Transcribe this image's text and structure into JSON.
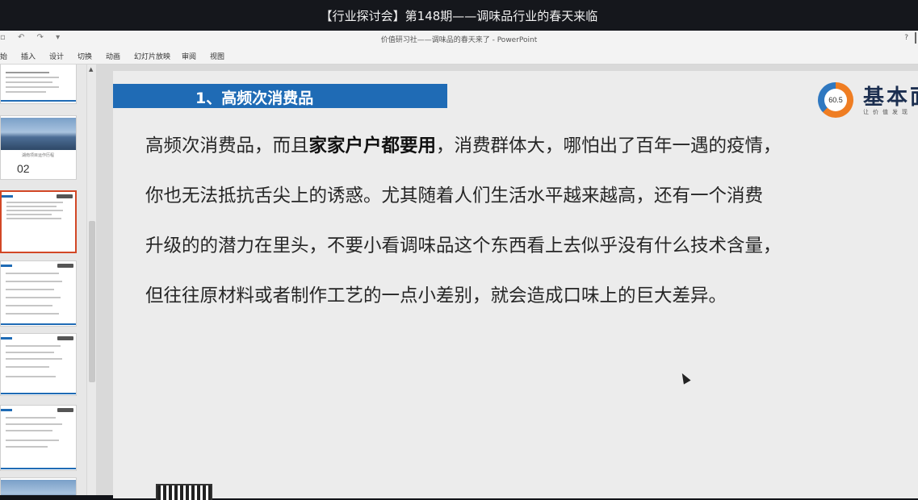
{
  "video": {
    "title": "【行业探讨会】第148期——调味品行业的春天来临"
  },
  "window": {
    "title": "价值研习社——调味品的春天来了 - PowerPoint",
    "help": "?"
  },
  "quick_access": {
    "icons": [
      "save-icon",
      "undo-icon",
      "redo-icon",
      "customize-icon"
    ]
  },
  "ribbon": {
    "tabs": [
      "始",
      "插入",
      "设计",
      "切换",
      "动画",
      "幻灯片放映",
      "审阅",
      "视图"
    ]
  },
  "thumbnails": {
    "section_number": "02",
    "section_caption": "湖南项目运作历程"
  },
  "slide": {
    "heading": "1、高频次消费品",
    "logo": {
      "score": "60.5",
      "name": "基本面",
      "tagline": "让价值发现"
    },
    "paragraph": {
      "line1_pre": "高频次消费品，而且",
      "line1_bold": "家家户户都要用",
      "line1_post": "，消费群体大，哪怕出了百年一遇的疫情，",
      "line2": "你也无法抵抗舌尖上的诱惑。尤其随着人们生活水平越来越高，还有一个消费",
      "line3": "升级的的潜力在里头，不要小看调味品这个东西看上去似乎没有什么技术含量，",
      "line4": "但往往原材料或者制作工艺的一点小差别，就会造成口味上的巨大差异。"
    }
  }
}
